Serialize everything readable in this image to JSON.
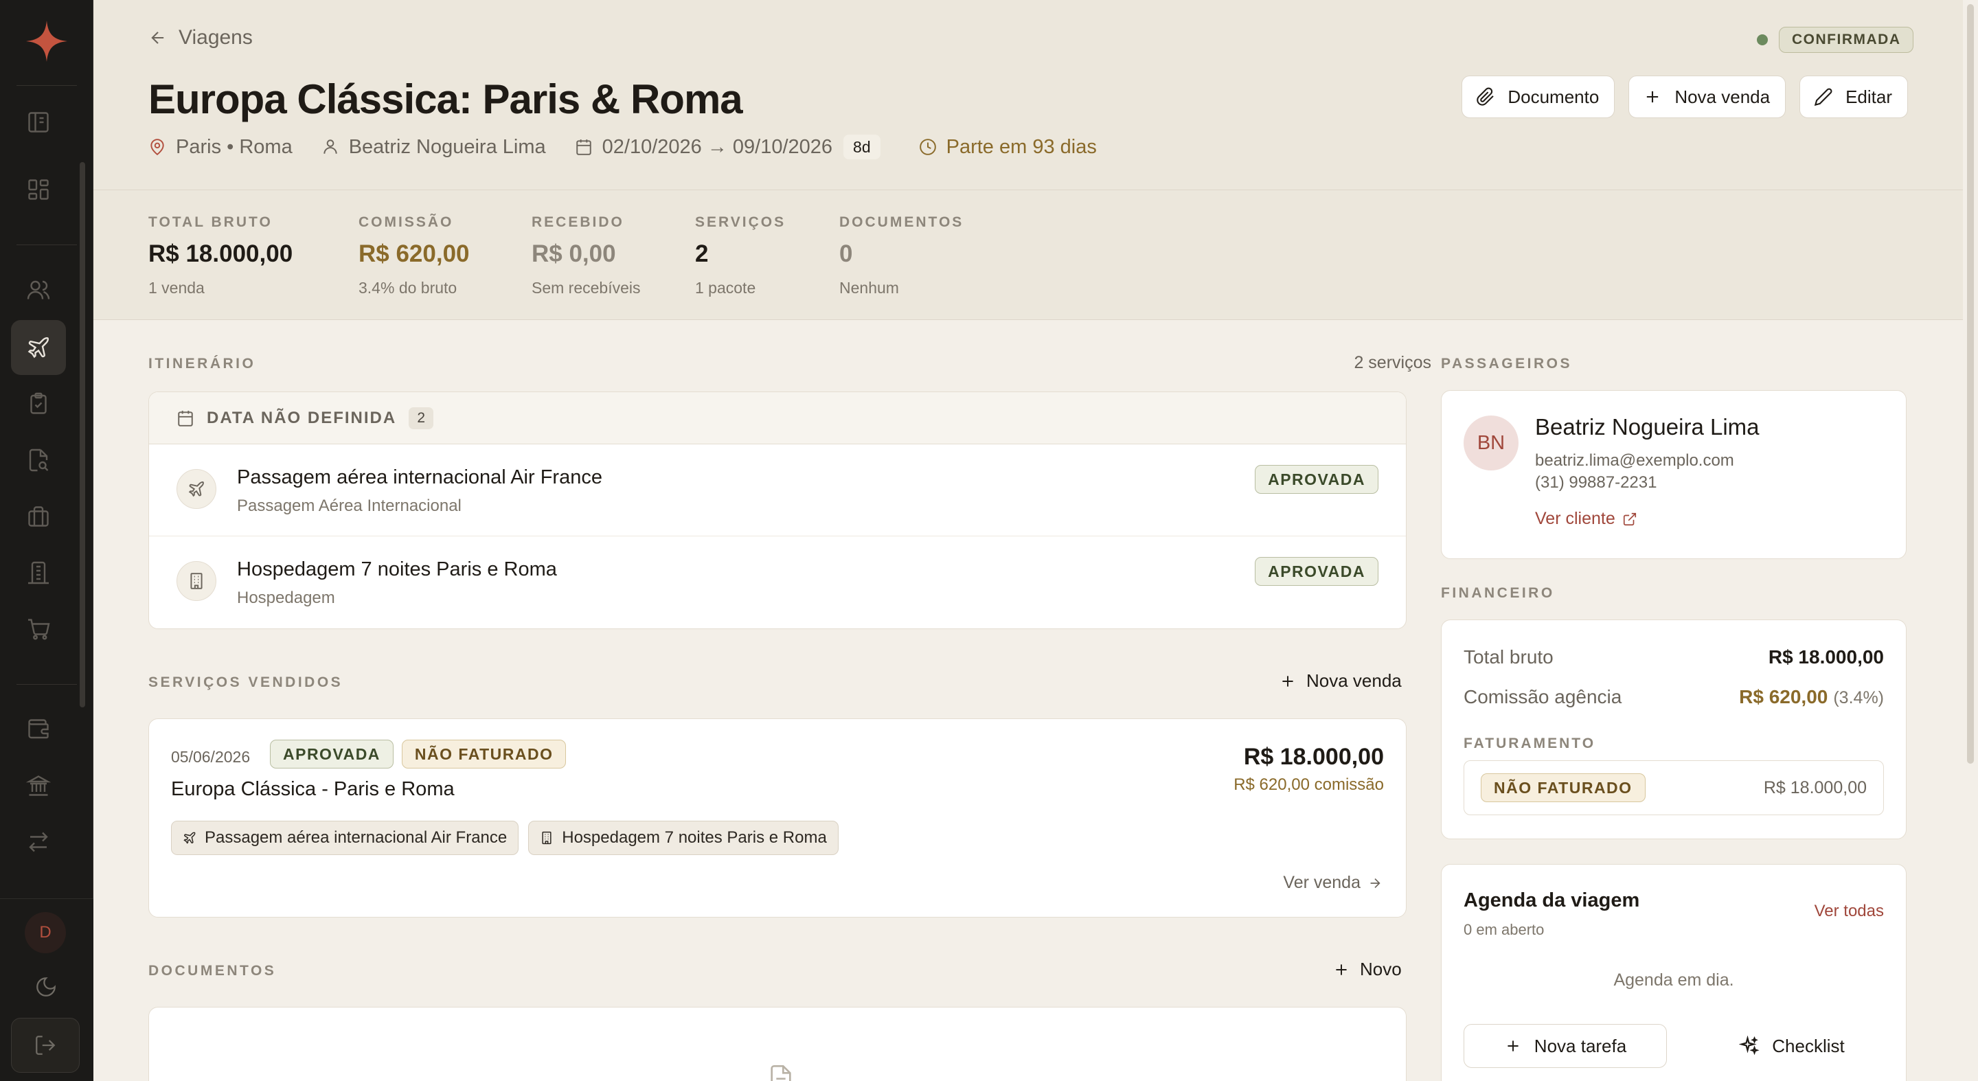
{
  "sidebar": {
    "logo_color": "#c4543f",
    "avatar_initial": "D",
    "items": [
      {
        "icon": "panel-icon"
      },
      {
        "icon": "dashboard-icon"
      },
      {
        "icon": "users-icon"
      },
      {
        "icon": "plane-icon",
        "active": true
      },
      {
        "icon": "clipboard-check-icon"
      },
      {
        "icon": "file-search-icon"
      },
      {
        "icon": "briefcase-icon"
      },
      {
        "icon": "building-icon"
      },
      {
        "icon": "cart-icon"
      },
      {
        "icon": "wallet-icon"
      },
      {
        "icon": "bank-icon"
      },
      {
        "icon": "transfer-icon"
      }
    ]
  },
  "header": {
    "back_label": "Viagens",
    "status": "CONFIRMADA",
    "title": "Europa Clássica: Paris & Roma",
    "destination": "Paris • Roma",
    "client": "Beatriz Nogueira Lima",
    "dates": "02/10/2026 → 09/10/2026",
    "duration": "8d",
    "departs": "Parte em 93 dias",
    "actions": {
      "document": "Documento",
      "new_sale": "Nova venda",
      "edit": "Editar"
    }
  },
  "kpis": [
    {
      "label": "TOTAL BRUTO",
      "value": "R$ 18.000,00",
      "sub": "1 venda"
    },
    {
      "label": "COMISSÃO",
      "value": "R$ 620,00",
      "sub": "3.4% do bruto"
    },
    {
      "label": "RECEBIDO",
      "value": "R$ 0,00",
      "sub": "Sem recebíveis"
    },
    {
      "label": "SERVIÇOS",
      "value": "2",
      "sub": "1 pacote"
    },
    {
      "label": "DOCUMENTOS",
      "value": "0",
      "sub": "Nenhum"
    }
  ],
  "itinerary": {
    "section": "ITINERÁRIO",
    "count": "2 serviços",
    "group_label": "DATA NÃO DEFINIDA",
    "group_count": "2",
    "items": [
      {
        "icon": "plane-icon",
        "title": "Passagem aérea internacional Air France",
        "subtitle": "Passagem Aérea Internacional",
        "status": "APROVADA"
      },
      {
        "icon": "hotel-icon",
        "title": "Hospedagem 7 noites Paris e Roma",
        "subtitle": "Hospedagem",
        "status": "APROVADA"
      }
    ]
  },
  "sales": {
    "section": "SERVIÇOS VENDIDOS",
    "new_label": "Nova venda",
    "sale": {
      "date": "05/06/2026",
      "status": "APROVADA",
      "billing": "NÃO FATURADO",
      "title": "Europa Clássica - Paris e Roma",
      "amount": "R$ 18.000,00",
      "commission": "R$ 620,00 comissão",
      "chips": [
        "Passagem aérea internacional Air France",
        "Hospedagem 7 noites Paris e Roma"
      ],
      "link": "Ver venda"
    }
  },
  "documents": {
    "section": "DOCUMENTOS",
    "new_label": "Novo"
  },
  "passengers": {
    "section": "PASSAGEIROS",
    "initials": "BN",
    "name": "Beatriz Nogueira Lima",
    "email": "beatriz.lima@exemplo.com",
    "phone": "(31) 99887-2231",
    "link": "Ver cliente"
  },
  "finance": {
    "section": "FINANCEIRO",
    "gross_label": "Total bruto",
    "gross_value": "R$ 18.000,00",
    "commission_label": "Comissão agência",
    "commission_value": "R$ 620,00",
    "commission_pct": "(3.4%)",
    "billing_section": "FATURAMENTO",
    "billing_status": "NÃO FATURADO",
    "billing_amount": "R$ 18.000,00"
  },
  "agenda": {
    "title": "Agenda da viagem",
    "open": "0 em aberto",
    "see_all": "Ver todas",
    "empty": "Agenda em dia.",
    "new_task": "Nova tarefa",
    "checklist": "Checklist"
  }
}
